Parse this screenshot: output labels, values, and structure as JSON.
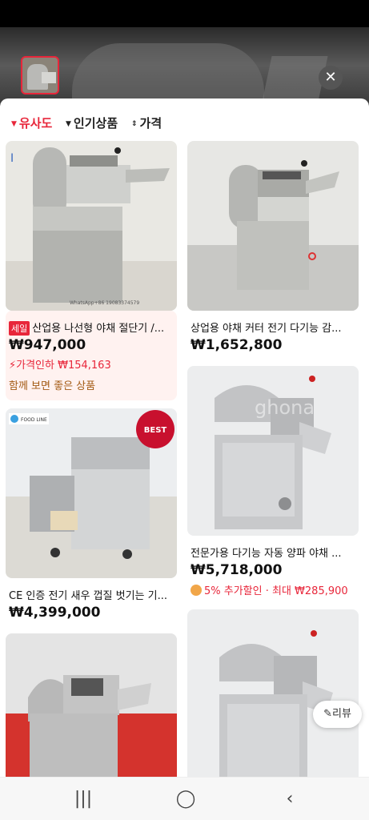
{
  "sort_tabs": [
    {
      "label": "유사도",
      "icon": "arrow-down"
    },
    {
      "label": "인기상품",
      "icon": "arrow-down"
    },
    {
      "label": "가격",
      "icon": "sort-up-down"
    }
  ],
  "products": [
    {
      "badge": "세일",
      "title": "산업용 나선형 야채 절단기 /...",
      "price": "₩947,000",
      "promo": "가격인하 ₩154,163",
      "bundle": "함께 보면 좋은 상품",
      "watermark": "WhatsApp+86 19083374579"
    },
    {
      "title": "상업용 야채 커터 전기 다기능 감...",
      "price": "₩1,652,800"
    },
    {
      "title": "CE 인증 전기 새우 껍질 벗기는 기...",
      "price": "₩4,399,000",
      "logo": "FOOD LINE",
      "seal": "BEST"
    },
    {
      "title": "전문가용 다기능 자동 양파 야채 ...",
      "price": "₩5,718,000",
      "coupon": "5% 추가할인 · 최대 ₩285,900",
      "watermark": "ghona"
    }
  ],
  "review_button": "리뷰",
  "colors": {
    "accent": "#e8263a",
    "promo_bg": "#fff2f0",
    "coupon": "#a35a13"
  }
}
